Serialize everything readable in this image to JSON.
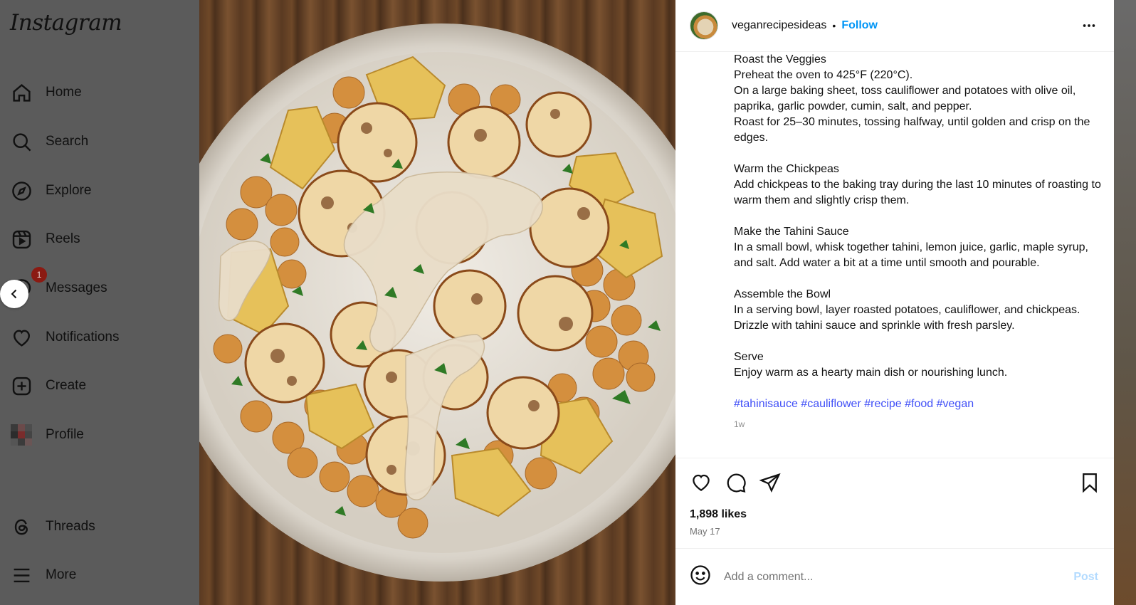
{
  "sidebar": {
    "logo": "Instagram",
    "items": [
      {
        "label": "Home"
      },
      {
        "label": "Search"
      },
      {
        "label": "Explore"
      },
      {
        "label": "Reels"
      },
      {
        "label": "Messages",
        "badge": "1"
      },
      {
        "label": "Notifications"
      },
      {
        "label": "Create"
      },
      {
        "label": "Profile"
      },
      {
        "label": "Threads"
      },
      {
        "label": "More"
      }
    ]
  },
  "post": {
    "username": "veganrecipesideas",
    "separator": "•",
    "follow_label": "Follow",
    "caption": [
      "Roast the Veggies\nPreheat the oven to 425°F (220°C).\nOn a large baking sheet, toss cauliflower and potatoes with olive oil, paprika, garlic powder, cumin, salt, and pepper.\nRoast for 25–30 minutes, tossing halfway, until golden and crisp on the edges.",
      "Warm the Chickpeas\nAdd chickpeas to the baking tray during the last 10 minutes of roasting to warm them and slightly crisp them.",
      "Make the Tahini Sauce\nIn a small bowl, whisk together tahini, lemon juice, garlic, maple syrup, and salt. Add water a bit at a time until smooth and pourable.",
      "Assemble the Bowl\nIn a serving bowl, layer roasted potatoes, cauliflower, and chickpeas.\nDrizzle with tahini sauce and sprinkle with fresh parsley.",
      "Serve\nEnjoy warm as a hearty main dish or nourishing lunch."
    ],
    "hashtags": "#tahinisauce #cauliflower #recipe #food #vegan",
    "caption_age": "1w",
    "likes": "1,898 likes",
    "date": "May 17",
    "comment_placeholder": "Add a comment...",
    "post_label": "Post"
  },
  "colors": {
    "link": "#0095f6",
    "hashtag": "#4150f7",
    "badge": "#8b1a12"
  }
}
